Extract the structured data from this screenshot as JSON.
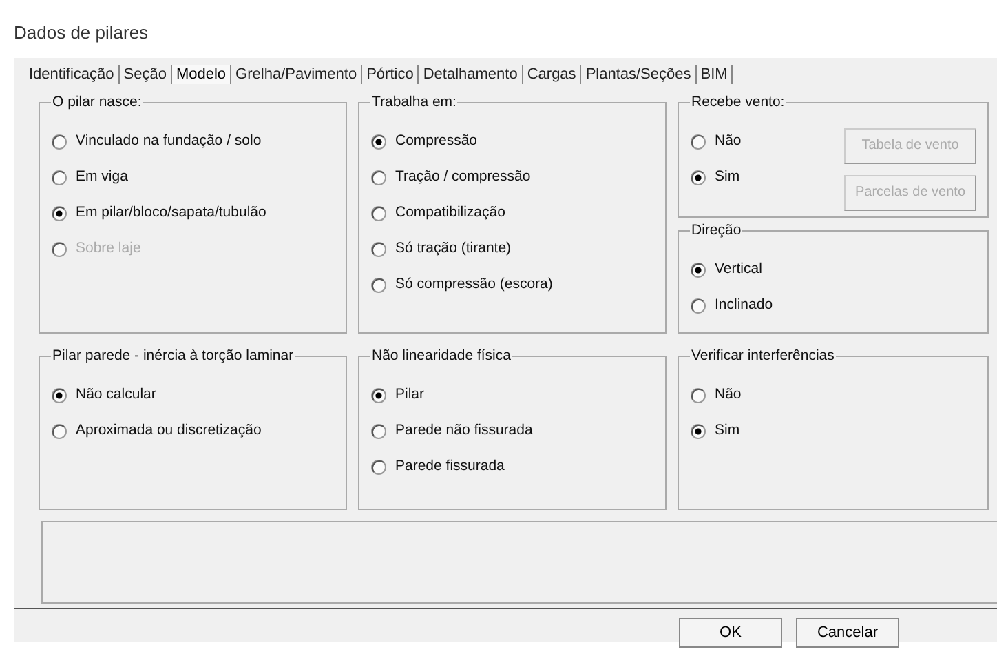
{
  "window": {
    "title": "Dados de pilares"
  },
  "tabs": [
    {
      "label": "Identificação",
      "selected": false
    },
    {
      "label": "Seção",
      "selected": false
    },
    {
      "label": "Modelo",
      "selected": true
    },
    {
      "label": "Grelha/Pavimento",
      "selected": false
    },
    {
      "label": "Pórtico",
      "selected": false
    },
    {
      "label": "Detalhamento",
      "selected": false
    },
    {
      "label": "Cargas",
      "selected": false
    },
    {
      "label": "Plantas/Seções",
      "selected": false
    },
    {
      "label": "BIM",
      "selected": false
    }
  ],
  "top_row": [
    [
      {
        "title": "O pilar nasce:",
        "options": [
          {
            "label": "Vinculado na fundação / solo",
            "selected": false,
            "disabled": false
          },
          {
            "label": "Em viga",
            "selected": false,
            "disabled": false
          },
          {
            "label": "Em pilar/bloco/sapata/tubulão",
            "selected": true,
            "disabled": false
          },
          {
            "label": "Sobre laje",
            "selected": false,
            "disabled": true
          }
        ]
      }
    ],
    [
      {
        "title": "Trabalha em:",
        "options": [
          {
            "label": "Compressão",
            "selected": true,
            "disabled": false
          },
          {
            "label": "Tração / compressão",
            "selected": false,
            "disabled": false
          },
          {
            "label": "Compatibilização",
            "selected": false,
            "disabled": false
          },
          {
            "label": "Só tração (tirante)",
            "selected": false,
            "disabled": false
          },
          {
            "label": "Só compressão (escora)",
            "selected": false,
            "disabled": false
          }
        ]
      }
    ],
    [
      {
        "title": "Recebe vento:",
        "options": [
          {
            "label": "Não",
            "selected": false,
            "disabled": false
          },
          {
            "label": "Sim",
            "selected": true,
            "disabled": false
          }
        ],
        "buttons": [
          {
            "label": "Tabela de vento",
            "disabled": true
          },
          {
            "label": "Parcelas de vento",
            "disabled": true
          }
        ]
      },
      {
        "title": "Direção",
        "options": [
          {
            "label": "Vertical",
            "selected": true,
            "disabled": false
          },
          {
            "label": "Inclinado",
            "selected": false,
            "disabled": false
          }
        ]
      }
    ]
  ],
  "bottom_row": [
    {
      "title": "Pilar parede - inércia à torção laminar",
      "options": [
        {
          "label": "Não calcular",
          "selected": true,
          "disabled": false
        },
        {
          "label": "Aproximada ou discretização",
          "selected": false,
          "disabled": false
        }
      ]
    },
    {
      "title": "Não linearidade física",
      "options": [
        {
          "label": "Pilar",
          "selected": true,
          "disabled": false
        },
        {
          "label": "Parede não fissurada",
          "selected": false,
          "disabled": false
        },
        {
          "label": "Parede fissurada",
          "selected": false,
          "disabled": false
        }
      ]
    },
    {
      "title": "Verificar interferências",
      "options": [
        {
          "label": "Não",
          "selected": false,
          "disabled": false
        },
        {
          "label": "Sim",
          "selected": true,
          "disabled": false
        }
      ]
    }
  ],
  "dialog_buttons": [
    "OK",
    "Cancelar"
  ]
}
